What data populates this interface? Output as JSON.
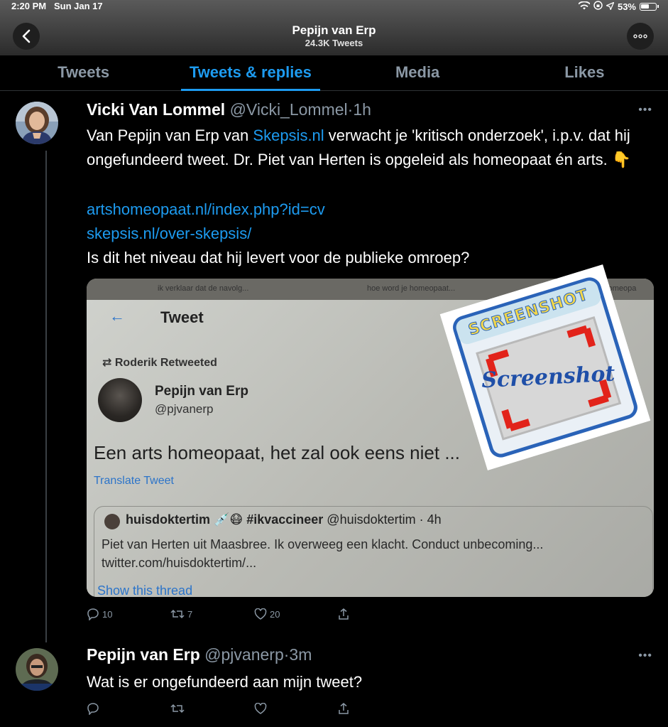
{
  "status_bar": {
    "time": "2:20 PM",
    "date": "Sun Jan 17",
    "battery": "53%"
  },
  "header": {
    "title": "Pepijn van Erp",
    "subtitle": "24.3K Tweets"
  },
  "tabs": [
    {
      "label": "Tweets",
      "active": false
    },
    {
      "label": "Tweets & replies",
      "active": true
    },
    {
      "label": "Media",
      "active": false
    },
    {
      "label": "Likes",
      "active": false
    }
  ],
  "tweet1": {
    "name": "Vicki Van Lommel",
    "handle": "@Vicki_Lommel",
    "time": "1h",
    "text_a": "Van Pepijn van Erp van ",
    "text_link": "Skepsis.nl",
    "text_b": " verwacht je 'kritisch onderzoek', i.p.v. dat hij ongefundeerd tweet. Dr. Piet van Herten is opgeleid als homeopaat én arts. 👇",
    "link1": "artshomeopaat.nl/index.php?id=cv",
    "link2": "skepsis.nl/over-skepsis/",
    "text_c": "Is dit het niveau dat hij levert voor de publieke omroep?",
    "replies": "10",
    "retweets": "7",
    "likes": "20",
    "media": {
      "browser_tab1": "ik verklaar dat de navolg...",
      "browser_tab2": "hoe word je homeopaat...",
      "browser_tab3": "word je homeopa",
      "back": "←",
      "title": "Tweet",
      "retweeted": "Roderik Retweeted",
      "name": "Pepijn van Erp",
      "handle": "@pjvanerp",
      "text": "Een arts homeopaat, het zal ook eens niet ...",
      "translate": "Translate Tweet",
      "quote_name": "huisdoktertim 💉😷 #ikvaccineer",
      "quote_handle": "@huisdoktertim · 4h",
      "quote_text": "Piet van Herten uit Maasbree. Ik overweeg een klacht. Conduct unbecoming...",
      "quote_link": "twitter.com/huisdoktertim/...",
      "show_thread": "Show this thread"
    },
    "sticker_top": "SCREENSHOT",
    "sticker_script": "Screenshot"
  },
  "tweet2": {
    "name": "Pepijn van Erp",
    "handle": "@pjvanerp",
    "time": "3m",
    "text": "Wat is er ongefundeerd aan mijn tweet?"
  },
  "colors": {
    "accent": "#1d9bf0",
    "muted": "#8b98a5",
    "background": "#000000"
  }
}
